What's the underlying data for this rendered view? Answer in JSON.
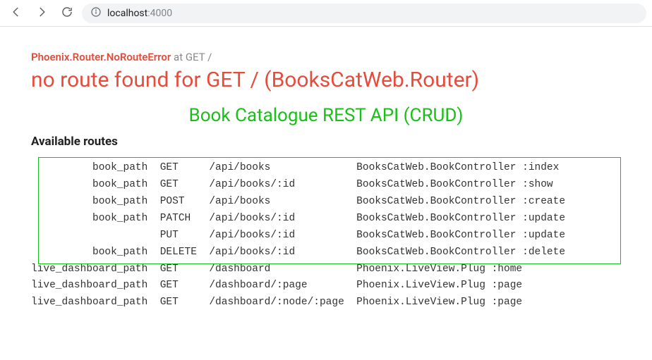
{
  "browser": {
    "host": "localhost",
    "port": ":4000"
  },
  "error": {
    "exception": "Phoenix.Router.NoRouteError",
    "at": "at",
    "request": "GET /",
    "headline": "no route found for GET / (BooksCatWeb.Router)"
  },
  "api_title": "Book Catalogue REST API (CRUD)",
  "routes_label": "Available routes",
  "routes": [
    {
      "helper": "book_path",
      "verb": "GET",
      "path": "/api/books",
      "action": "BooksCatWeb.BookController :index"
    },
    {
      "helper": "book_path",
      "verb": "GET",
      "path": "/api/books/:id",
      "action": "BooksCatWeb.BookController :show"
    },
    {
      "helper": "book_path",
      "verb": "POST",
      "path": "/api/books",
      "action": "BooksCatWeb.BookController :create"
    },
    {
      "helper": "book_path",
      "verb": "PATCH",
      "path": "/api/books/:id",
      "action": "BooksCatWeb.BookController :update"
    },
    {
      "helper": "",
      "verb": "PUT",
      "path": "/api/books/:id",
      "action": "BooksCatWeb.BookController :update"
    },
    {
      "helper": "book_path",
      "verb": "DELETE",
      "path": "/api/books/:id",
      "action": "BooksCatWeb.BookController :delete"
    },
    {
      "helper": "live_dashboard_path",
      "verb": "GET",
      "path": "/dashboard",
      "action": "Phoenix.LiveView.Plug :home"
    },
    {
      "helper": "live_dashboard_path",
      "verb": "GET",
      "path": "/dashboard/:page",
      "action": "Phoenix.LiveView.Plug :page"
    },
    {
      "helper": "live_dashboard_path",
      "verb": "GET",
      "path": "/dashboard/:node/:page",
      "action": "Phoenix.LiveView.Plug :page"
    }
  ],
  "highlight_box": {
    "start": 0,
    "end": 5
  }
}
